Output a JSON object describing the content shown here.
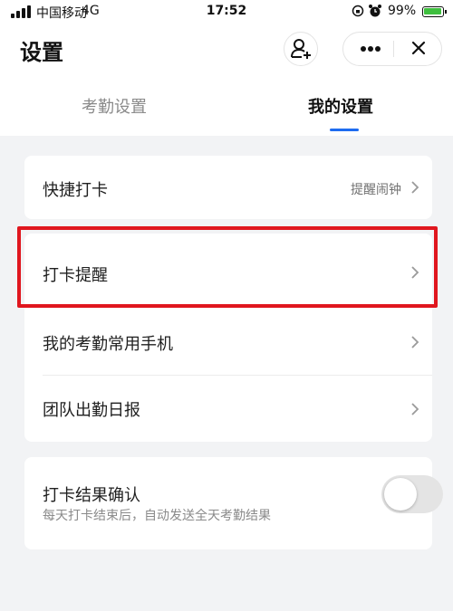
{
  "status_bar": {
    "carrier": "中国移动",
    "network": "4G",
    "time": "17:52",
    "battery_percent": "99%",
    "battery_level": 0.99
  },
  "header": {
    "title": "设置"
  },
  "tabs": [
    {
      "label": "考勤设置",
      "active": false
    },
    {
      "label": "我的设置",
      "active": true
    }
  ],
  "settings": {
    "quick_punch": {
      "label": "快捷打卡",
      "value": "提醒闹钟"
    },
    "punch_reminder": {
      "label": "打卡提醒"
    },
    "common_phone": {
      "label": "我的考勤常用手机"
    },
    "team_daily": {
      "label": "团队出勤日报"
    },
    "result_confirm": {
      "label": "打卡结果确认",
      "description": "每天打卡结束后，自动发送全天考勤结果",
      "enabled": false
    }
  },
  "colors": {
    "accent": "#1e6cf0",
    "highlight": "#e0161e",
    "background": "#f2f3f5"
  }
}
